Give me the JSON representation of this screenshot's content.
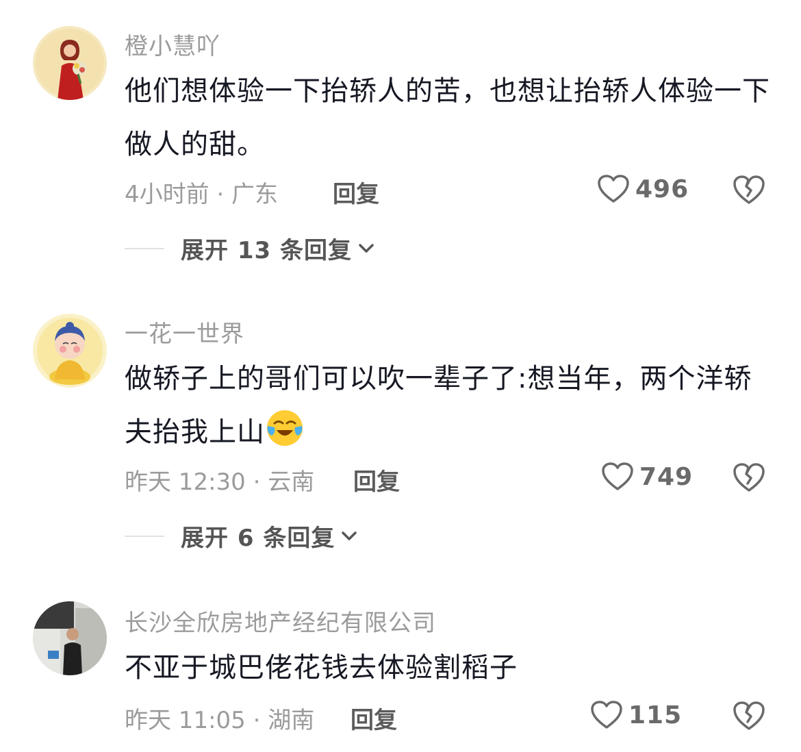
{
  "comments": [
    {
      "username": "橙小慧吖",
      "text": "他们想体验一下抬轿人的苦，也想让抬轿人体验一下做人的甜。",
      "meta": "4小时前 · 广东",
      "reply_label": "回复",
      "likes": "496",
      "expand_label": "展开 13 条回复",
      "avatar_icon": "woman-with-flowers-avatar"
    },
    {
      "username": "一花一世界",
      "text": "做轿子上的哥们可以吹一辈子了:想当年，两个洋轿夫抬我上山",
      "emoji": "crying-laughing-emoji",
      "meta": "昨天 12:30 · 云南",
      "reply_label": "回复",
      "likes": "749",
      "expand_label": "展开 6 条回复",
      "avatar_icon": "buddha-cartoon-avatar"
    },
    {
      "username": "长沙全欣房地产经纪有限公司",
      "text": "不亚于城巴佬花钱去体验割稻子",
      "meta": "昨天 11:05 · 湖南",
      "reply_label": "回复",
      "likes": "115",
      "avatar_icon": "man-photo-avatar"
    }
  ],
  "colors": {
    "text": "#161823",
    "secondary": "#9b9b9b",
    "icon": "#6a6a6a"
  }
}
